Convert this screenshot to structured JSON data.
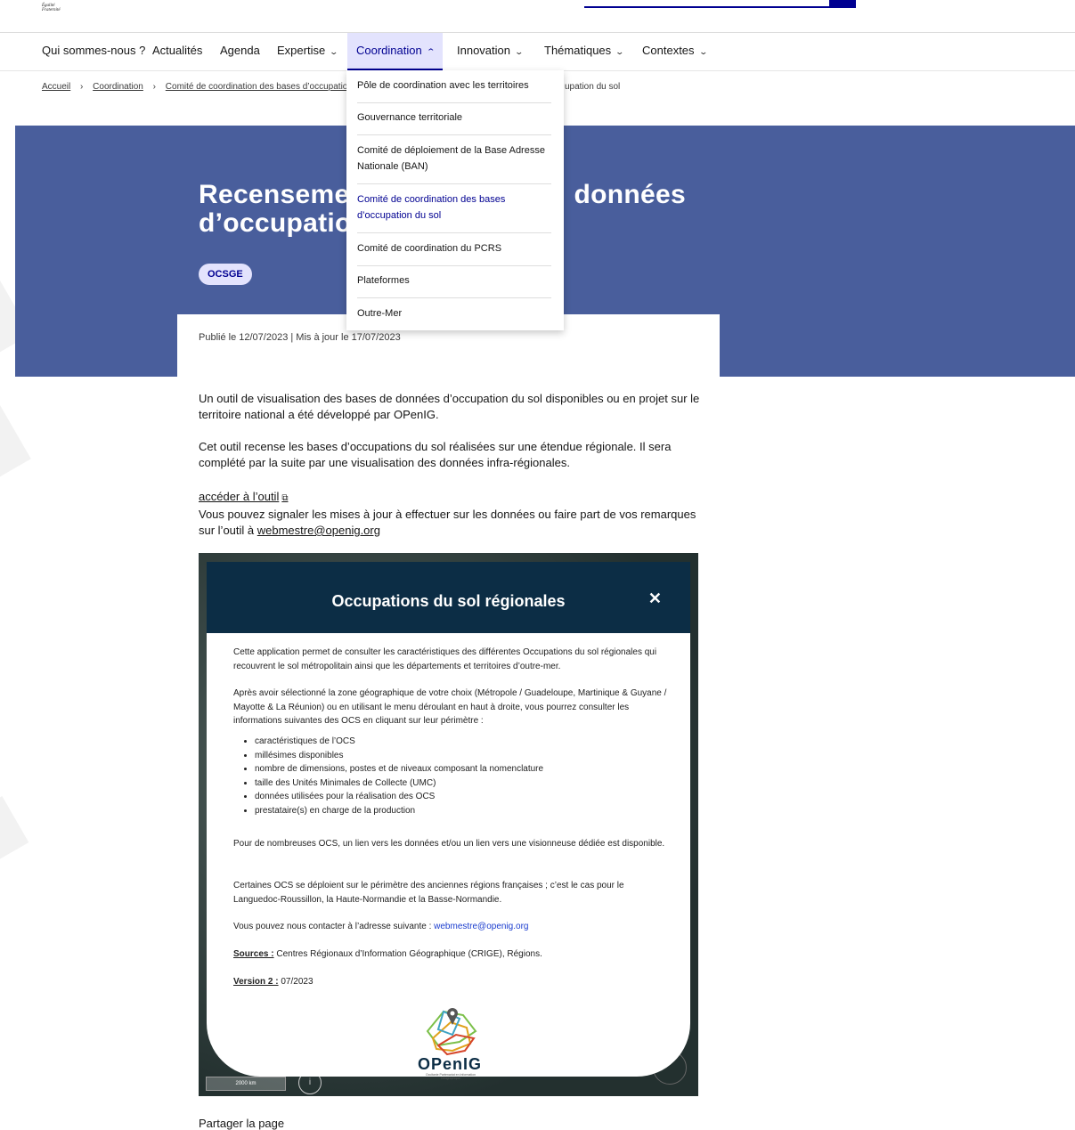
{
  "header": {
    "mottos": [
      "Égalité",
      "Fraternité"
    ]
  },
  "nav": {
    "items": [
      {
        "label": "Qui sommes-nous ?",
        "has_menu": false
      },
      {
        "label": "Actualités",
        "has_menu": false
      },
      {
        "label": "Agenda",
        "has_menu": false
      },
      {
        "label": "Expertise",
        "has_menu": true,
        "chevron": "⌄"
      },
      {
        "label": "Coordination",
        "has_menu": true,
        "chevron": "⌃",
        "active": true
      },
      {
        "label": "Innovation",
        "has_menu": true,
        "chevron": "⌄"
      },
      {
        "label": "Thématiques",
        "has_menu": true,
        "chevron": "⌄"
      },
      {
        "label": "Contextes",
        "has_menu": true,
        "chevron": "⌄"
      }
    ]
  },
  "dropdown": {
    "items": [
      "Pôle de coordination avec les territoires",
      "Gouvernance territoriale",
      "Comité de déploiement de la Base Adresse Nationale (BAN)",
      "Comité de coordination des bases d’occupation du sol",
      "Comité de coordination du PCRS",
      "Plateformes",
      "Outre-Mer"
    ]
  },
  "breadcrumb": {
    "home": "Accueil",
    "section": "Coordination",
    "sub": "Comité de coordination des bases d’occupatio",
    "separator": "›",
    "current_tail": "upation du sol"
  },
  "hero": {
    "title_line1": "Recenseme",
    "title_line1_end": "données",
    "title_line2": "d’occupatio",
    "tag": "OCSGE"
  },
  "article": {
    "published": "Publié le 12/07/2023 | Mis à jour le 17/07/2023",
    "p1": "Un outil de visualisation des bases de données d’occupation du sol disponibles ou en projet sur le territoire national a été développé par OPenIG.",
    "p2": "Cet outil recense les bases d’occupations du sol réalisées sur une étendue régionale. Il sera complété par la suite par une visualisation des données infra-régionales.",
    "tool_link": "accéder à l’outil",
    "ext_icon": "external-link-icon",
    "p3_prefix": "Vous pouvez signaler les mises à jour à effectuer sur les données ou faire part de vos remarques sur l’outil à ",
    "email": "webmestre@openig.org",
    "share": "Partager la page"
  },
  "embed": {
    "title": "Occupations du sol régionales",
    "close": "✕",
    "intro": "Cette application permet de consulter les caractéristiques des différentes Occupations du sol régionales qui recouvrent le sol métropolitain ainsi que les départements et territoires d’outre-mer.",
    "select_text": "Après avoir sélectionné la zone géographique de votre choix (Métropole / Guadeloupe, Martinique & Guyane / Mayotte & La Réunion) ou en utilisant le menu déroulant en haut à droite, vous pourrez consulter les informations suivantes des OCS en cliquant sur leur périmètre :",
    "list": [
      "caractéristiques de l’OCS",
      "millésimes disponibles",
      "nombre de dimensions, postes et de niveaux composant la nomenclature",
      "taille des Unités Minimales de Collecte (UMC)",
      "données utilisées pour la réalisation des OCS",
      "prestataire(s) en charge de la production"
    ],
    "links_text": "Pour de nombreuses OCS, un lien vers les données et/ou un lien vers une visionneuse dédiée est disponible.",
    "regions_text": "Certaines OCS se déploient sur le périmètre des anciennes régions françaises ; c’est le cas pour le Languedoc-Roussillon, la Haute-Normandie et la Basse-Normandie.",
    "contact_prefix": "Vous pouvez nous contacter à l’adresse suivante : ",
    "contact_email": "webmestre@openig.org",
    "sources_label": "Sources :",
    "sources_value": " Centres Régionaux d’Information Géographique (CRIGE), Régions.",
    "version_label": "Version 2 :",
    "version_value": " 07/2023",
    "logo_text": "OPenIG",
    "logo_sub": "Occitanie Partenariat en Information Géographique",
    "scale": "2000 km",
    "info_icon": "i"
  },
  "colors": {
    "primary": "#000091",
    "hero_bg": "#495e9c",
    "modal_head": "#0c2d45",
    "tag_bg": "#e3e3fd"
  }
}
